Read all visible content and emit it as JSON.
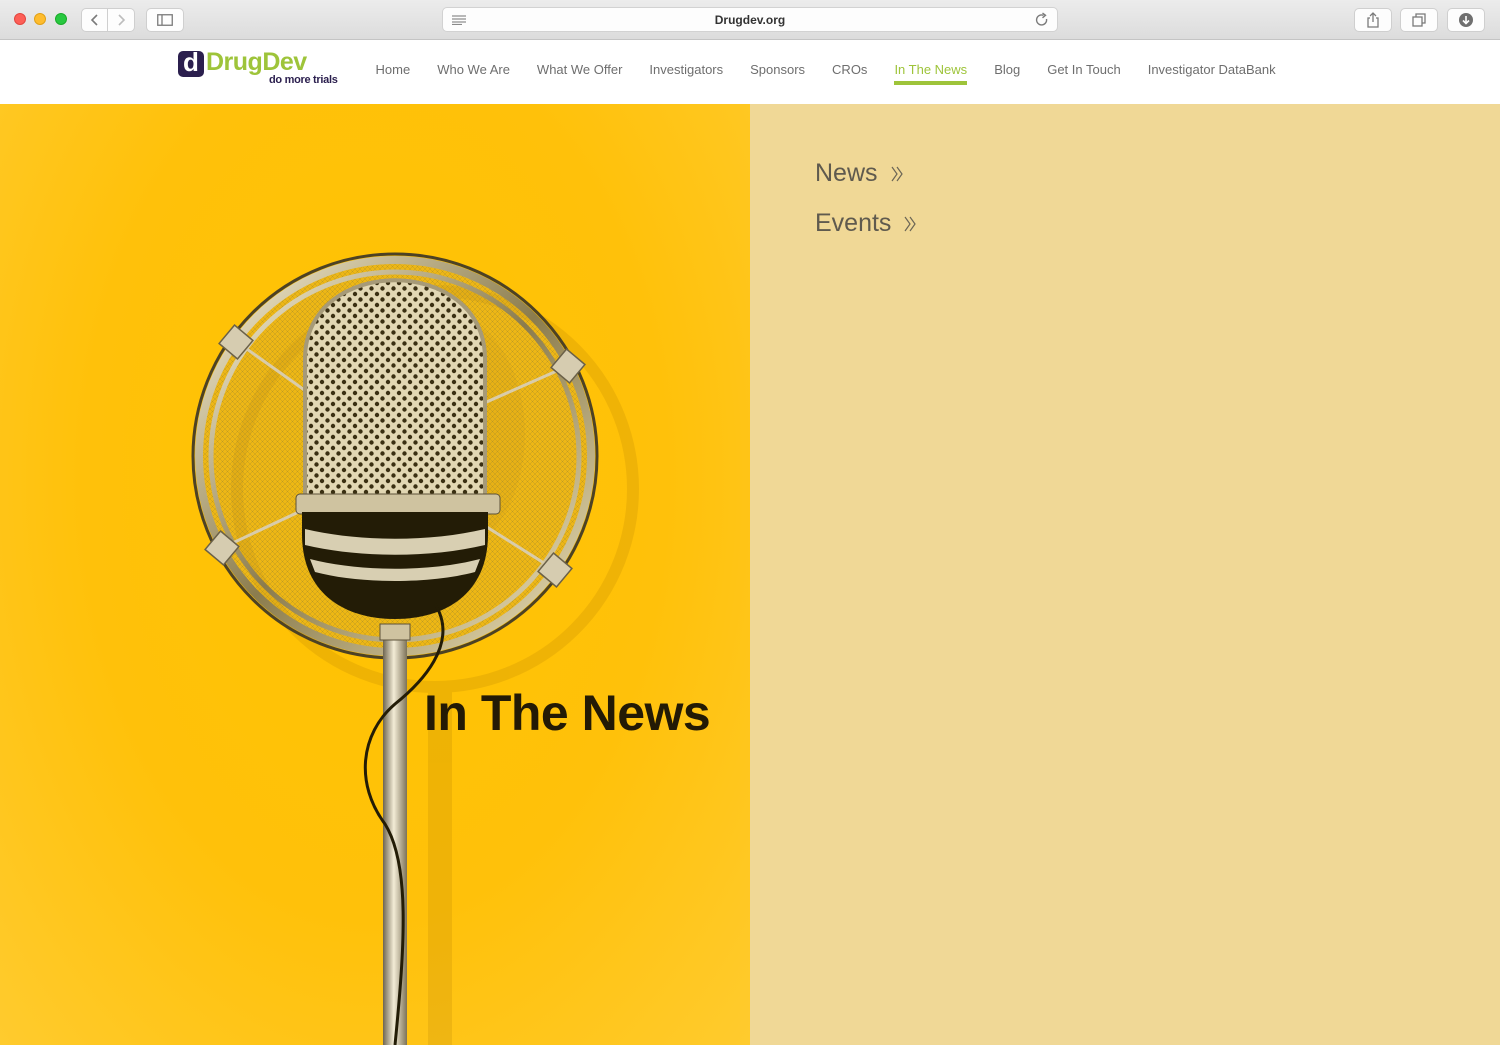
{
  "browser": {
    "url": "Drugdev.org",
    "buttons": [
      "back",
      "forward",
      "sidebar",
      "share",
      "tabs",
      "downloads"
    ]
  },
  "site": {
    "logo": {
      "mark": "d",
      "word": "DrugDev",
      "tagline": "do more trials"
    },
    "nav": [
      {
        "label": "Home",
        "active": false
      },
      {
        "label": "Who We Are",
        "active": false
      },
      {
        "label": "What We Offer",
        "active": false
      },
      {
        "label": "Investigators",
        "active": false
      },
      {
        "label": "Sponsors",
        "active": false
      },
      {
        "label": "CROs",
        "active": false
      },
      {
        "label": "In The News",
        "active": true
      },
      {
        "label": "Blog",
        "active": false
      },
      {
        "label": "Get In Touch",
        "active": false
      },
      {
        "label": "Investigator DataBank",
        "active": false
      }
    ]
  },
  "hero": {
    "title": "In The News",
    "image": "vintage-microphone-illustration"
  },
  "sidebar": {
    "links": [
      {
        "label": "News",
        "icon": "double-chevron-right-icon"
      },
      {
        "label": "Events",
        "icon": "double-chevron-right-icon"
      }
    ]
  },
  "colors": {
    "brand_green": "#9ec43a",
    "brand_purple": "#2b1f4e",
    "hero_yellow": "#ffc300",
    "panel_beige": "#f0d896"
  }
}
